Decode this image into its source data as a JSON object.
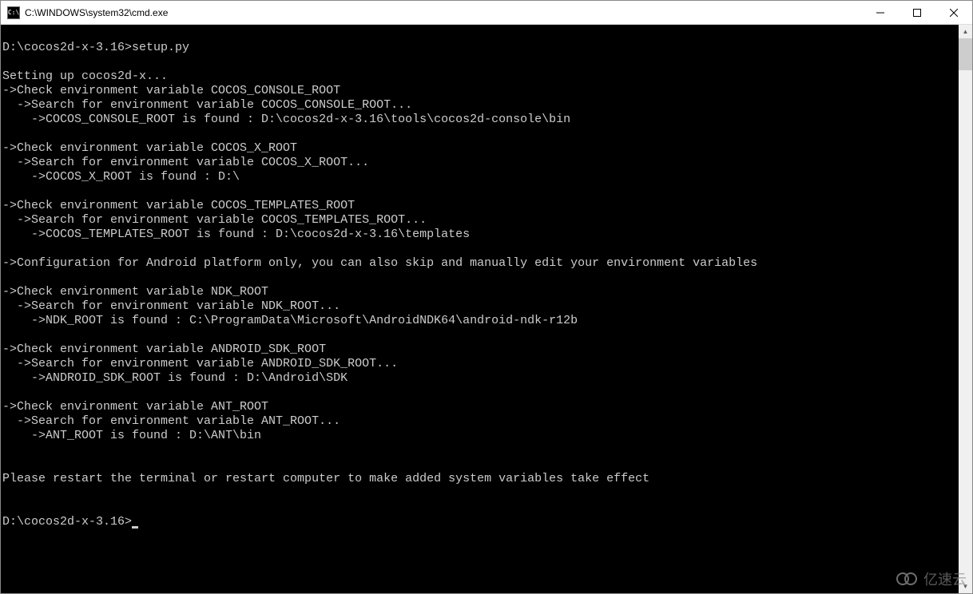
{
  "window": {
    "title": "C:\\WINDOWS\\system32\\cmd.exe",
    "icon_label": "C:\\"
  },
  "terminal": {
    "lines": [
      "",
      "D:\\cocos2d-x-3.16>setup.py",
      "",
      "Setting up cocos2d-x...",
      "->Check environment variable COCOS_CONSOLE_ROOT",
      "  ->Search for environment variable COCOS_CONSOLE_ROOT...",
      "    ->COCOS_CONSOLE_ROOT is found : D:\\cocos2d-x-3.16\\tools\\cocos2d-console\\bin",
      "",
      "->Check environment variable COCOS_X_ROOT",
      "  ->Search for environment variable COCOS_X_ROOT...",
      "    ->COCOS_X_ROOT is found : D:\\",
      "",
      "->Check environment variable COCOS_TEMPLATES_ROOT",
      "  ->Search for environment variable COCOS_TEMPLATES_ROOT...",
      "    ->COCOS_TEMPLATES_ROOT is found : D:\\cocos2d-x-3.16\\templates",
      "",
      "->Configuration for Android platform only, you can also skip and manually edit your environment variables",
      "",
      "->Check environment variable NDK_ROOT",
      "  ->Search for environment variable NDK_ROOT...",
      "    ->NDK_ROOT is found : C:\\ProgramData\\Microsoft\\AndroidNDK64\\android-ndk-r12b",
      "",
      "->Check environment variable ANDROID_SDK_ROOT",
      "  ->Search for environment variable ANDROID_SDK_ROOT...",
      "    ->ANDROID_SDK_ROOT is found : D:\\Android\\SDK",
      "",
      "->Check environment variable ANT_ROOT",
      "  ->Search for environment variable ANT_ROOT...",
      "    ->ANT_ROOT is found : D:\\ANT\\bin",
      "",
      "",
      "Please restart the terminal or restart computer to make added system variables take effect",
      "",
      ""
    ],
    "prompt": "D:\\cocos2d-x-3.16>"
  },
  "watermark": {
    "text": "亿速云"
  }
}
